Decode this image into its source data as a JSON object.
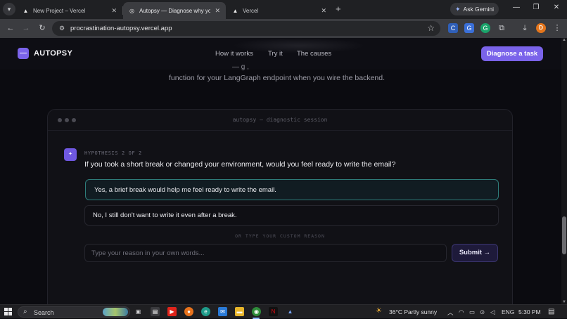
{
  "browser": {
    "tabs": [
      {
        "title": "New Project – Vercel",
        "favicon": "▲",
        "active": false
      },
      {
        "title": "Autopsy — Diagnose why you'r",
        "favicon": "◎",
        "active": true
      },
      {
        "title": "Vercel",
        "favicon": "▲",
        "active": false
      }
    ],
    "tab_close_glyph": "✕",
    "new_tab_glyph": "+",
    "gemini_label": "Ask Gemini",
    "url": "procrastination-autopsy.vercel.app",
    "window_controls": {
      "minimize": "—",
      "restore": "❐",
      "close": "✕"
    },
    "profile_initial": "D"
  },
  "site": {
    "logo_mark": "—",
    "logo_text": "AUTOPSY",
    "nav": [
      "How it works",
      "Try it",
      "The causes"
    ],
    "cta_label": "Diagnose a task",
    "intro_partial": "—                     g                                                 ,",
    "intro_line": "function for your LangGraph endpoint when you wire the backend."
  },
  "session": {
    "title": "autopsy — diagnostic session",
    "hypothesis_icon": "✦",
    "hypothesis_label": "HYPOTHESIS 2 OF 2",
    "question": "If you took a short break or changed your environment, would you feel ready to write the email?",
    "options": [
      {
        "label": "Yes, a brief break would help me feel ready to write the email.",
        "selected": true
      },
      {
        "label": "No, I still don't want to write it even after a break.",
        "selected": false
      }
    ],
    "or_label": "OR TYPE YOUR CUSTOM REASON",
    "input_placeholder": "Type your reason in your own words...",
    "submit_label": "Submit →"
  },
  "taskbar": {
    "search_label": "Search",
    "weather": "36°C  Partly sunny",
    "language": "ENG",
    "time": "5:30 PM"
  },
  "colors": {
    "accent": "#7a63ea",
    "selected_border": "#2e7c7a",
    "page_bg": "#0b0b10"
  }
}
